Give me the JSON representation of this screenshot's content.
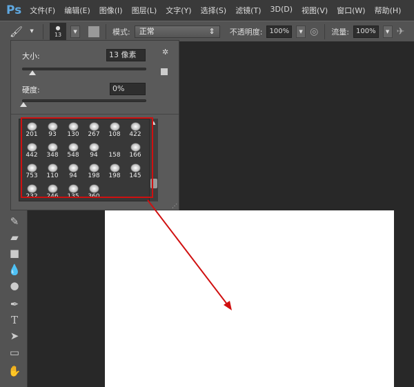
{
  "app": {
    "logo": "Ps"
  },
  "menu": [
    "文件(F)",
    "编辑(E)",
    "图像(I)",
    "图层(L)",
    "文字(Y)",
    "选择(S)",
    "滤镜(T)",
    "3D(D)",
    "视图(V)",
    "窗口(W)",
    "帮助(H)"
  ],
  "options": {
    "brush_size": "13",
    "mode_label": "模式:",
    "mode_value": "正常",
    "opacity_label": "不透明度:",
    "opacity_value": "100%",
    "flow_label": "流量:",
    "flow_value": "100%"
  },
  "brush_panel": {
    "size_label": "大小:",
    "size_value": "13 像素",
    "size_fraction": 0.03,
    "hardness_label": "硬度:",
    "hardness_value": "0%",
    "hardness_fraction": 0,
    "presets": [
      "201",
      "93",
      "130",
      "267",
      "108",
      "422",
      "442",
      "348",
      "548",
      "94",
      "158",
      "166",
      "753",
      "110",
      "94",
      "198",
      "198",
      "145",
      "232",
      "246",
      "135",
      "360"
    ]
  },
  "colors": {
    "highlight": "#d01010"
  }
}
